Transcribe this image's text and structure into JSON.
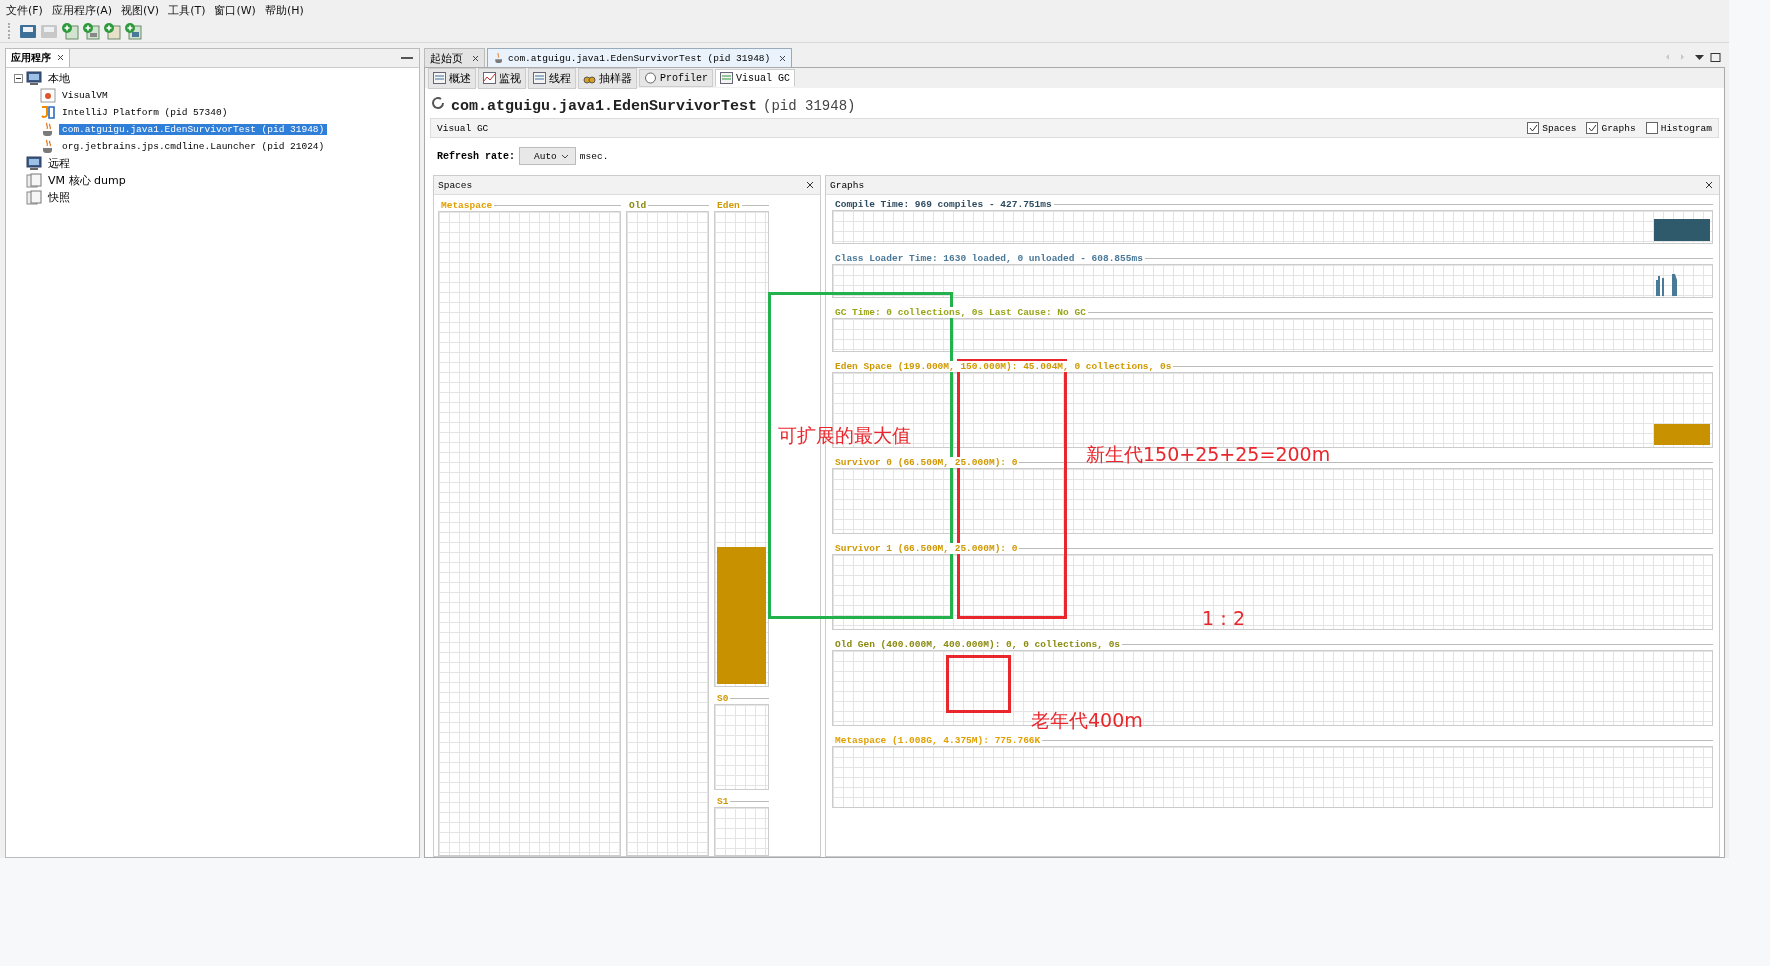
{
  "menu": [
    "文件(F)",
    "应用程序(A)",
    "视图(V)",
    "工具(T)",
    "窗口(W)",
    "帮助(H)"
  ],
  "toolbar_buttons": [
    {
      "kind": "open",
      "disabled": false
    },
    {
      "kind": "save",
      "disabled": true
    },
    {
      "kind": "add",
      "disabled": false
    },
    {
      "kind": "addjmx",
      "disabled": false
    },
    {
      "kind": "dump",
      "disabled": false
    },
    {
      "kind": "snapshot",
      "disabled": false
    }
  ],
  "sidebar": {
    "tab": "应用程序",
    "tree": [
      {
        "label": "本地",
        "kind": "computer",
        "selected": false,
        "expanded": true,
        "children": [
          {
            "label": "VisualVM",
            "kind": "visualvm",
            "selected": false
          },
          {
            "label": "IntelliJ Platform (pid 57340)",
            "kind": "intellij",
            "selected": false
          },
          {
            "label": "com.atguigu.java1.EdenSurvivorTest (pid 31948)",
            "kind": "java",
            "selected": true
          },
          {
            "label": "org.jetbrains.jps.cmdline.Launcher (pid 21024)",
            "kind": "java",
            "selected": false
          }
        ]
      },
      {
        "label": "远程",
        "kind": "remote",
        "selected": false
      },
      {
        "label": "VM 核心 dump",
        "kind": "dump",
        "selected": false
      },
      {
        "label": "快照",
        "kind": "snapshot",
        "selected": false
      }
    ]
  },
  "document_tabs": [
    {
      "label": "起始页",
      "kind": "plain",
      "selected": false
    },
    {
      "label": "com.atguigu.java1.EdenSurvivorTest (pid 31948)",
      "kind": "java",
      "selected": true
    }
  ],
  "view_tabs": [
    {
      "label": "概述",
      "kind": "overview",
      "selected": false
    },
    {
      "label": "监视",
      "kind": "monitor",
      "selected": false
    },
    {
      "label": "线程",
      "kind": "threads",
      "selected": false
    },
    {
      "label": "抽样器",
      "kind": "sampler",
      "selected": false
    },
    {
      "label": "Profiler",
      "kind": "profiler",
      "selected": false
    },
    {
      "label": "Visual GC",
      "kind": "visualgc",
      "selected": true
    }
  ],
  "app_title": {
    "name": "com.atguigu.java1.EdenSurvivorTest",
    "pid": "(pid 31948)"
  },
  "section_bar": {
    "title": "Visual GC",
    "options": [
      {
        "label": "Spaces",
        "checked": true
      },
      {
        "label": "Graphs",
        "checked": true
      },
      {
        "label": "Histogram",
        "checked": false
      }
    ]
  },
  "refresh": {
    "label": "Refresh rate:",
    "value": "Auto",
    "unit": "msec."
  },
  "spaces": {
    "title": "Spaces",
    "columns": [
      {
        "label": "Metaspace",
        "color": "#e0a000",
        "level": 0
      },
      {
        "label": "Old",
        "color": "#8a8a10",
        "level": 0
      },
      {
        "label": "Eden",
        "color": "#d09800",
        "level": 0.29
      },
      {
        "label": "S0",
        "color": "#d09800"
      },
      {
        "label": "S1",
        "color": "#d09800"
      }
    ]
  },
  "graphs": {
    "title": "Graphs",
    "items": [
      {
        "label": "Compile Time: 969 compiles - 427.751ms",
        "color": "#2c4a60",
        "kind": "block"
      },
      {
        "label": "Class Loader Time: 1630 loaded, 0 unloaded - 608.855ms",
        "color": "#4a7898",
        "kind": "spikes"
      },
      {
        "label": "GC Time: 0 collections, 0s Last Cause: No GC",
        "color": "#98a418",
        "kind": "flat"
      },
      {
        "label": "Eden Space (199.000M, 150.000M): 45.004M, 0 collections, 0s",
        "color": "#d09800",
        "kind": "block"
      },
      {
        "label": "Survivor 0 (66.500M, 25.000M): 0",
        "color": "#d09800",
        "kind": "flat"
      },
      {
        "label": "Survivor 1 (66.500M, 25.000M): 0",
        "color": "#d09800",
        "kind": "flat"
      },
      {
        "label": "Old Gen (400.000M, 400.000M): 0, 0 collections, 0s",
        "color": "#8a8a10",
        "kind": "flat"
      },
      {
        "label": "Metaspace (1.008G, 4.375M): 775.766K",
        "color": "#e0a000",
        "kind": "flat"
      }
    ]
  },
  "annotations": {
    "frames": [
      {
        "color": "#22b14c"
      },
      {
        "color": "#e8262b"
      },
      {
        "color": "#e8262b"
      }
    ],
    "notes": [
      "可扩展的最大值",
      "新生代150+25+25=200m",
      "1：2",
      "老年代400m"
    ]
  }
}
